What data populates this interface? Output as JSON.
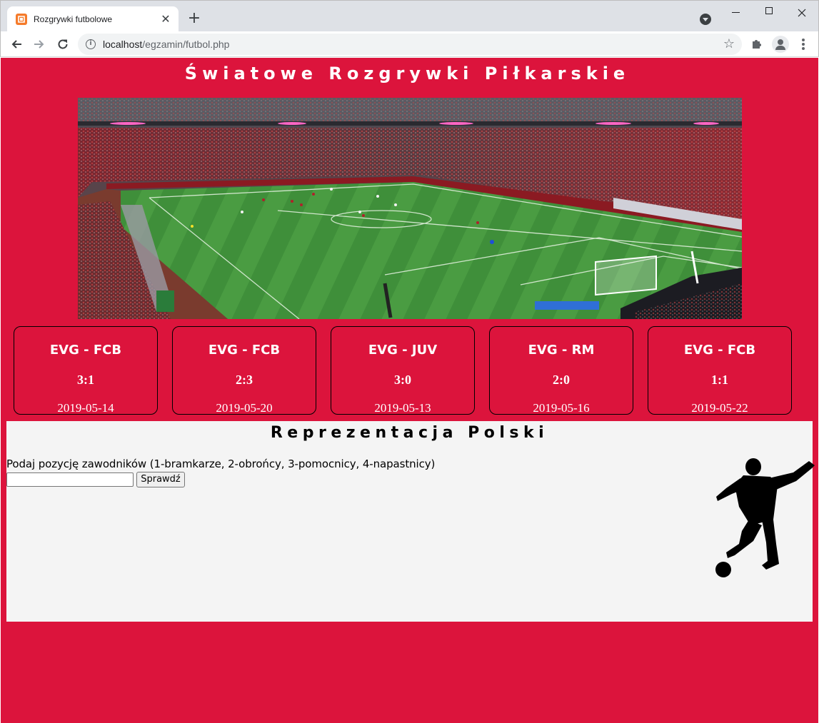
{
  "browser": {
    "tab_title": "Rozgrywki futbolowe",
    "favicon_text": "□",
    "close_glyph": "✕",
    "new_tab_glyph": "+",
    "url_host": "localhost",
    "url_path": "/egzamin/futbol.php"
  },
  "page": {
    "title": "Światowe Rozgrywki Piłkarskie",
    "matches": [
      {
        "teams": "EVG - FCB",
        "score": "3:1",
        "date": "2019-05-14"
      },
      {
        "teams": "EVG - FCB",
        "score": "2:3",
        "date": "2019-05-20"
      },
      {
        "teams": "EVG - JUV",
        "score": "3:0",
        "date": "2019-05-13"
      },
      {
        "teams": "EVG - RM",
        "score": "2:0",
        "date": "2019-05-16"
      },
      {
        "teams": "EVG - FCB",
        "score": "1:1",
        "date": "2019-05-22"
      }
    ],
    "section": {
      "title": "Reprezentacja Polski",
      "prompt": "Podaj pozycję zawodników (1-bramkarze, 2-obrońcy, 3-pomocnicy, 4-napastnicy)",
      "input_value": "",
      "button_label": "Sprawdź"
    }
  },
  "colors": {
    "page_background": "#dc143c",
    "section_background": "#f4f4f4",
    "tab_strip": "#dee1e6"
  },
  "icons": {
    "favicon": "xampp-icon",
    "back": "arrow-left-icon",
    "forward": "arrow-right-icon",
    "reload": "reload-icon",
    "info": "info-icon",
    "bookmark": "star-icon",
    "extensions": "puzzle-icon",
    "profile": "avatar-icon",
    "menu": "kebab-menu-icon"
  }
}
